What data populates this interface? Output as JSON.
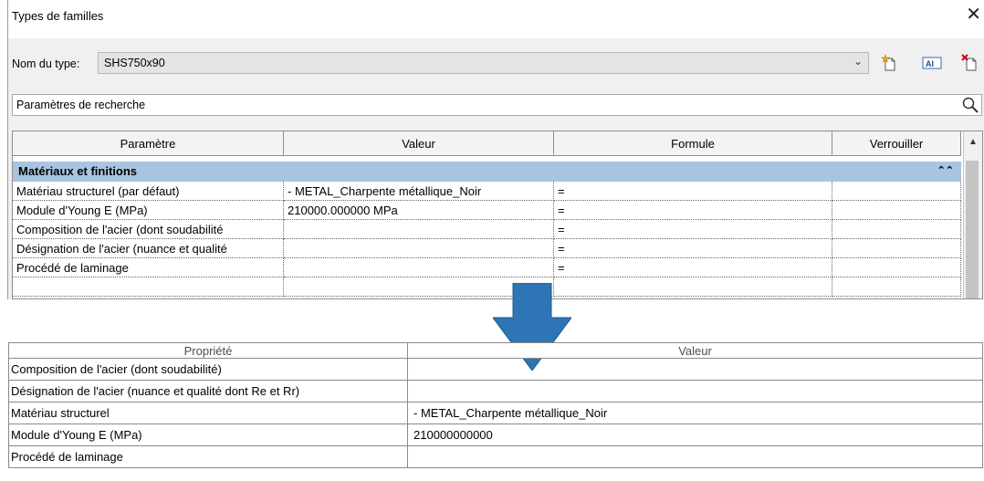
{
  "dialog": {
    "title": "Types de familles",
    "close_icon": "close-icon",
    "type_label": "Nom du type:",
    "type_value": "SHS750x90",
    "toolbar_icons": [
      "new-type-icon",
      "rename-type-icon",
      "delete-type-icon"
    ],
    "search_placeholder": "Paramètres de recherche",
    "columns": [
      "Paramètre",
      "Valeur",
      "Formule",
      "Verrouiller"
    ],
    "group": "Matériaux et finitions",
    "rows": [
      {
        "param": "Matériau structurel (par défaut)",
        "value": "- METAL_Charpente métallique_Noir",
        "formula": "="
      },
      {
        "param": "Module d'Young E (MPa)",
        "value": "210000.000000 MPa",
        "formula": "="
      },
      {
        "param": "Composition de l'acier (dont soudabilité",
        "value": "",
        "formula": "="
      },
      {
        "param": "Désignation de l'acier (nuance et qualité",
        "value": "",
        "formula": "="
      },
      {
        "param": "Procédé de laminage",
        "value": "",
        "formula": "="
      }
    ]
  },
  "arrow": {
    "color": "#2e75b6"
  },
  "property_table": {
    "columns": [
      "Propriété",
      "Valeur"
    ],
    "rows": [
      {
        "prop": "Composition de l'acier (dont soudabilité)",
        "value": ""
      },
      {
        "prop": "Désignation de l'acier (nuance et qualité dont Re et Rr)",
        "value": ""
      },
      {
        "prop": "Matériau structurel",
        "value": "- METAL_Charpente métallique_Noir"
      },
      {
        "prop": "Module d'Young E (MPa)",
        "value": "210000000000"
      },
      {
        "prop": "Procédé de laminage",
        "value": ""
      }
    ]
  }
}
